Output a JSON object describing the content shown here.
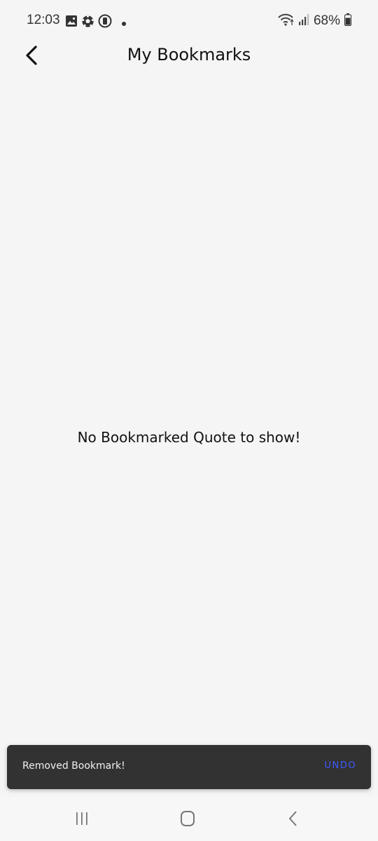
{
  "status_bar": {
    "time": "12:03",
    "battery": "68%",
    "icons_left": [
      "gallery-icon",
      "soccer-ball-icon",
      "record-icon",
      "dot-icon"
    ],
    "icons_right": [
      "wifi-icon",
      "signal-icon",
      "battery-icon"
    ]
  },
  "app_bar": {
    "title": "My Bookmarks",
    "back_icon": "chevron-left-icon"
  },
  "empty_state": {
    "message": "No Bookmarked Quote to show!"
  },
  "snackbar": {
    "message": "Removed Bookmark!",
    "action_label": "UNDO",
    "action_color": "#3d5afe",
    "background": "#323232"
  },
  "nav_bar": {
    "buttons": [
      "recent-apps-icon",
      "home-icon",
      "back-icon"
    ]
  }
}
